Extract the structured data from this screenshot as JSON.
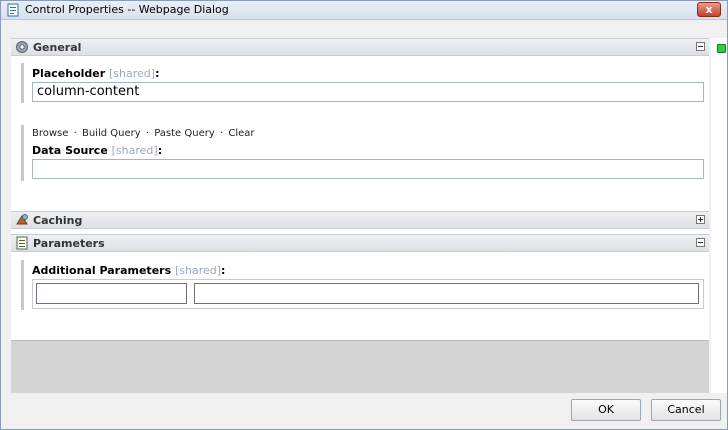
{
  "window": {
    "title": "Control Properties -- Webpage Dialog",
    "close_label": "x"
  },
  "sections": {
    "general": {
      "title": "General"
    },
    "caching": {
      "title": "Caching"
    },
    "parameters": {
      "title": "Parameters"
    }
  },
  "general": {
    "placeholder": {
      "label": "Placeholder",
      "shared": "[shared]",
      "colon": ":",
      "value": "column-content"
    },
    "links": [
      "Browse",
      "Build Query",
      "Paste Query",
      "Clear"
    ],
    "link_separator": "·",
    "data_source": {
      "label": "Data Source",
      "shared": "[shared]",
      "colon": ":",
      "value": ""
    }
  },
  "parameters": {
    "additional": {
      "label": "Additional Parameters",
      "shared": "[shared]",
      "colon": ":",
      "name_value": "",
      "value_value": ""
    }
  },
  "footer": {
    "ok_label": "OK",
    "cancel_label": "Cancel"
  },
  "icons": {
    "title": "page-icon",
    "general": "gear-icon",
    "caching": "caching-icon",
    "parameters": "list-icon"
  },
  "colors": {
    "status_indicator": "#2ecc40",
    "shared_text": "#9aa8c0"
  }
}
